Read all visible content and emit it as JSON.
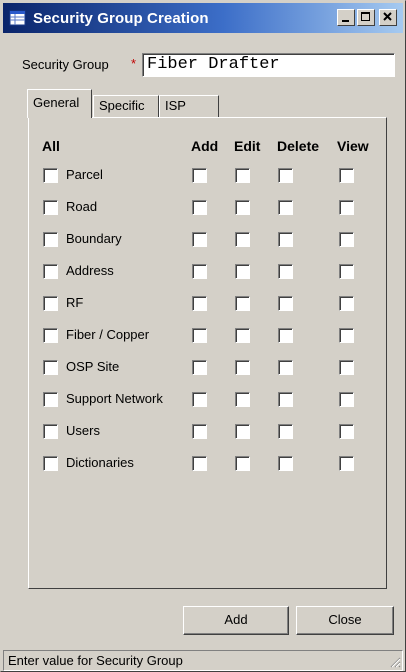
{
  "window": {
    "title": "Security Group Creation",
    "icon": "table-icon"
  },
  "form": {
    "security_group_label": "Security Group",
    "required_marker": "*",
    "security_group_value": "Fiber Drafter"
  },
  "tabs": [
    {
      "label": "General",
      "active": true
    },
    {
      "label": "Specific",
      "active": false
    },
    {
      "label": "ISP",
      "active": false
    }
  ],
  "permissions": {
    "headers": {
      "all": "All",
      "add": "Add",
      "edit": "Edit",
      "delete": "Delete",
      "view": "View"
    },
    "rows": [
      {
        "label": "Parcel"
      },
      {
        "label": "Road"
      },
      {
        "label": "Boundary"
      },
      {
        "label": "Address"
      },
      {
        "label": "RF"
      },
      {
        "label": "Fiber / Copper"
      },
      {
        "label": "OSP Site"
      },
      {
        "label": "Support Network"
      },
      {
        "label": "Users"
      },
      {
        "label": "Dictionaries"
      }
    ]
  },
  "buttons": {
    "add": "Add",
    "close": "Close"
  },
  "status": {
    "text": "Enter value for Security Group"
  }
}
